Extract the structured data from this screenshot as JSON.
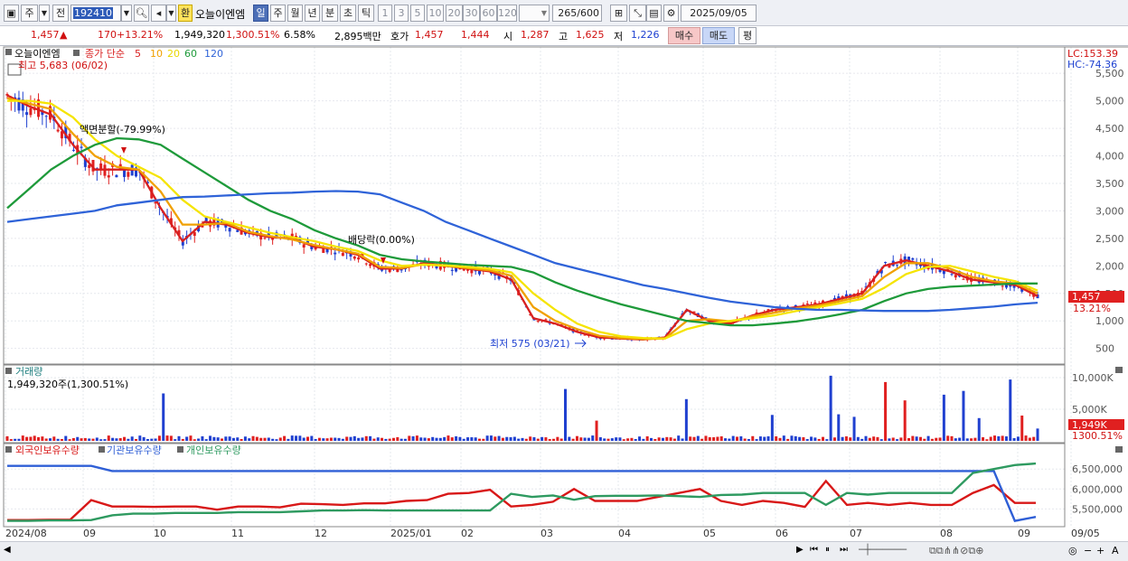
{
  "toolbar": {
    "market": "주",
    "prev": "전",
    "code": "192410",
    "badge": "환",
    "stock_name": "오늘이엔엠",
    "periods": [
      "일",
      "주",
      "월",
      "년",
      "분",
      "초",
      "틱"
    ],
    "numbers": [
      "1",
      "3",
      "5",
      "10",
      "20",
      "30",
      "60",
      "120"
    ],
    "count": "265",
    "count_total": "/600",
    "date": "2025/09/05"
  },
  "quote": {
    "price": "1,457",
    "arrow": "▲",
    "change": "170",
    "change_pct": "+13.21%",
    "volume": "1,949,320",
    "volume_pct": "1,300.51%",
    "turnover_pct": "6.58%",
    "amount": "2,895백만",
    "ask_label": "호가",
    "ask1": "1,457",
    "ask2": "1,444",
    "open_label": "시",
    "open": "1,287",
    "high_label": "고",
    "high": "1,625",
    "low_label": "저",
    "low": "1,226",
    "buy": "매수",
    "sell": "매도",
    "avg": "평"
  },
  "price_panel": {
    "stock_label": "오늘이엔엠",
    "ma_label": "종가 단순",
    "ma_periods": [
      "5",
      "10",
      "20",
      "60",
      "120"
    ],
    "ma_colors": [
      "#d82020",
      "#f0a000",
      "#f5e400",
      "#1e9a3a",
      "#2f63d8"
    ],
    "high_note": "최고 5,683 (06/02)",
    "low_note": "최저 575 (03/21)",
    "split_note": "액면분할(-79.99%)",
    "div_note": "배당락(0.00%)",
    "lc": "LC:153.39",
    "hc": "HC:-74.36",
    "price_box": "1,457",
    "pct_box": "13.21%"
  },
  "volume_panel": {
    "title": "거래량",
    "value": "1,949,320주(1,300.51%)",
    "box": "1,949K",
    "box_pct": "1300.51%"
  },
  "holdings_panel": {
    "series": [
      "외국인보유수량",
      "기관보유수량",
      "개인보유수량"
    ],
    "colors": [
      "#d81818",
      "#2f5fd6",
      "#2e9a60"
    ]
  },
  "chart_data": [
    {
      "type": "line",
      "title": "",
      "x_ticks": [
        "2024/08",
        "09",
        "10",
        "11",
        "12",
        "2025/01",
        "02",
        "03",
        "04",
        "05",
        "06",
        "07",
        "08",
        "09",
        "09/05"
      ],
      "y_ticks": [
        500,
        1000,
        1500,
        2000,
        2500,
        3000,
        3500,
        4000,
        4500,
        5000,
        5500
      ],
      "ylim": [
        330,
        5700
      ],
      "series": [
        {
          "name": "5",
          "color": "#d82020",
          "values": [
            5100,
            4900,
            4750,
            4200,
            3750,
            3750,
            3750,
            3050,
            2450,
            2800,
            2750,
            2600,
            2520,
            2500,
            2350,
            2300,
            2200,
            1950,
            1950,
            2050,
            2000,
            1950,
            1900,
            1750,
            1050,
            950,
            800,
            700,
            680,
            660,
            700,
            1200,
            1000,
            950,
            1100,
            1200,
            1250,
            1300,
            1400,
            1500,
            2000,
            2100,
            2000,
            1900,
            1750,
            1700,
            1650,
            1450
          ]
        },
        {
          "name": "10",
          "color": "#f0a000",
          "values": [
            5050,
            4950,
            4850,
            4400,
            4000,
            3800,
            3750,
            3350,
            2750,
            2750,
            2780,
            2620,
            2540,
            2480,
            2380,
            2300,
            2220,
            1980,
            1960,
            2030,
            2000,
            1960,
            1920,
            1820,
            1250,
            1000,
            850,
            730,
            690,
            670,
            680,
            1000,
            1030,
            990,
            1080,
            1150,
            1230,
            1280,
            1360,
            1450,
            1800,
            2050,
            2050,
            1950,
            1800,
            1720,
            1680,
            1500
          ]
        },
        {
          "name": "20",
          "color": "#f5e400",
          "values": [
            5000,
            5000,
            4950,
            4700,
            4300,
            4000,
            3800,
            3600,
            3200,
            2900,
            2800,
            2700,
            2600,
            2520,
            2450,
            2350,
            2270,
            2100,
            2000,
            2020,
            2010,
            1980,
            1950,
            1880,
            1500,
            1200,
            950,
            800,
            720,
            690,
            680,
            850,
            950,
            1000,
            1050,
            1100,
            1180,
            1250,
            1320,
            1400,
            1600,
            1850,
            1980,
            2000,
            1900,
            1800,
            1720,
            1550
          ]
        },
        {
          "name": "60",
          "color": "#1e9a3a",
          "values": [
            3050,
            3400,
            3750,
            4000,
            4200,
            4320,
            4300,
            4200,
            3950,
            3700,
            3450,
            3200,
            3000,
            2850,
            2650,
            2500,
            2370,
            2200,
            2120,
            2080,
            2050,
            2020,
            2000,
            1980,
            1880,
            1700,
            1550,
            1420,
            1300,
            1200,
            1100,
            1000,
            960,
            920,
            920,
            950,
            990,
            1050,
            1120,
            1200,
            1360,
            1500,
            1580,
            1620,
            1640,
            1660,
            1680,
            1680
          ]
        },
        {
          "name": "120",
          "color": "#2f63d8",
          "values": [
            2800,
            2850,
            2900,
            2950,
            3000,
            3100,
            3150,
            3200,
            3250,
            3260,
            3280,
            3300,
            3320,
            3330,
            3350,
            3360,
            3350,
            3300,
            3150,
            3000,
            2800,
            2650,
            2500,
            2350,
            2200,
            2050,
            1950,
            1850,
            1750,
            1650,
            1580,
            1500,
            1420,
            1350,
            1300,
            1250,
            1220,
            1200,
            1200,
            1190,
            1180,
            1180,
            1180,
            1200,
            1230,
            1260,
            1300,
            1330
          ]
        }
      ]
    },
    {
      "type": "bar",
      "title": "거래량",
      "y_ticks": [
        "5,000K",
        "10,000K"
      ],
      "ylim": [
        0,
        11000
      ]
    },
    {
      "type": "line",
      "title": "",
      "y_ticks": [
        "5,500,000",
        "6,000,000",
        "6,500,000"
      ],
      "ylim": [
        5100000,
        6800000
      ],
      "series": [
        {
          "name": "외국인보유수량",
          "color": "#d81818",
          "values": [
            5220000,
            5220000,
            5230000,
            5230000,
            5720000,
            5560000,
            5560000,
            5550000,
            5560000,
            5560000,
            5480000,
            5560000,
            5560000,
            5540000,
            5630000,
            5620000,
            5600000,
            5640000,
            5640000,
            5700000,
            5720000,
            5880000,
            5900000,
            5980000,
            5560000,
            5600000,
            5680000,
            6000000,
            5700000,
            5700000,
            5700000,
            5800000,
            5900000,
            6000000,
            5700000,
            5600000,
            5700000,
            5650000,
            5550000,
            6200000,
            5600000,
            5650000,
            5600000,
            5650000,
            5600000,
            5600000,
            5900000,
            6100000,
            5650000,
            5650000
          ]
        },
        {
          "name": "기관보유수량",
          "color": "#2f5fd6",
          "values": [
            6580000,
            6580000,
            6580000,
            6580000,
            6580000,
            6450000,
            6450000,
            6450000,
            6450000,
            6450000,
            6450000,
            6450000,
            6450000,
            6450000,
            6450000,
            6450000,
            6450000,
            6450000,
            6450000,
            6450000,
            6450000,
            6450000,
            6450000,
            6450000,
            6450000,
            6450000,
            6450000,
            6450000,
            6450000,
            6450000,
            6450000,
            6450000,
            6450000,
            6450000,
            6450000,
            6450000,
            6450000,
            6450000,
            6450000,
            6450000,
            6450000,
            6450000,
            6450000,
            6450000,
            6450000,
            6450000,
            6450000,
            6450000,
            5200000,
            5300000
          ]
        },
        {
          "name": "개인보유수량",
          "color": "#2e9a60",
          "values": [
            5200000,
            5200000,
            5210000,
            5210000,
            5220000,
            5340000,
            5380000,
            5380000,
            5400000,
            5400000,
            5400000,
            5420000,
            5420000,
            5420000,
            5440000,
            5460000,
            5460000,
            5470000,
            5460000,
            5460000,
            5460000,
            5460000,
            5460000,
            5460000,
            5880000,
            5800000,
            5840000,
            5730000,
            5820000,
            5830000,
            5830000,
            5840000,
            5820000,
            5800000,
            5850000,
            5860000,
            5900000,
            5900000,
            5900000,
            5600000,
            5900000,
            5860000,
            5900000,
            5900000,
            5900000,
            5900000,
            6400000,
            6500000,
            6600000,
            6640000
          ]
        }
      ]
    }
  ]
}
